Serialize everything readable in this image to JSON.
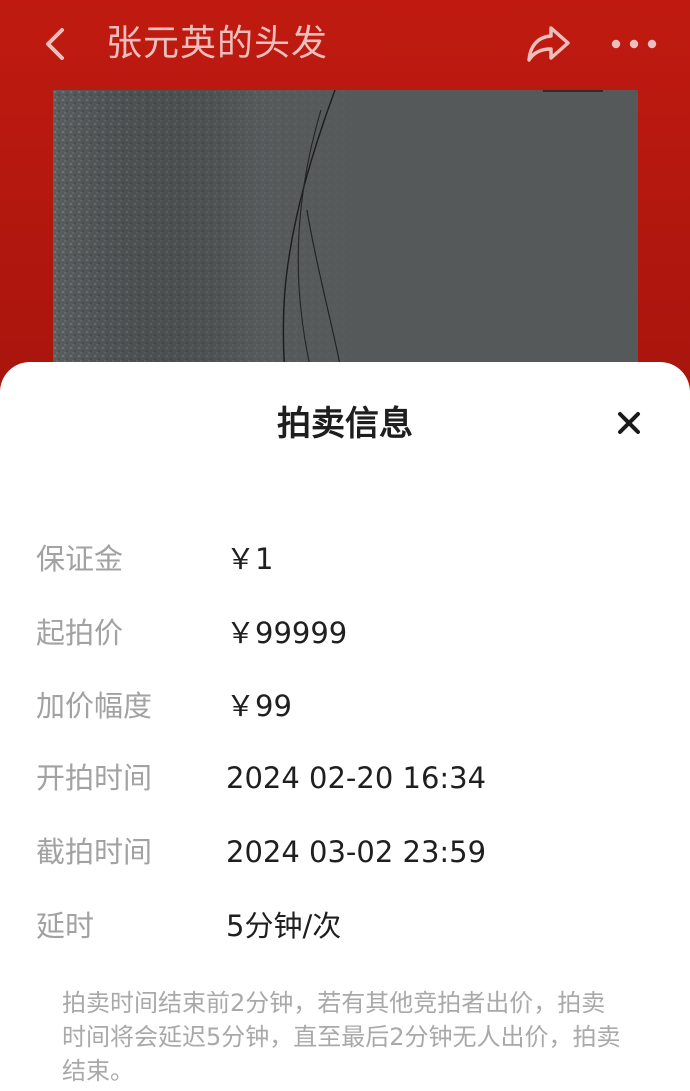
{
  "header": {
    "title": "张元英的头发",
    "back_icon": "chevron-left-icon",
    "share_icon": "share-icon",
    "more_icon": "more-horizontal-icon"
  },
  "product_image": {
    "description_icon": "product-photo"
  },
  "auction_sheet": {
    "title": "拍卖信息",
    "close_icon": "close-icon",
    "rows": [
      {
        "label": "保证金",
        "value": "￥1"
      },
      {
        "label": "起拍价",
        "value": "￥99999"
      },
      {
        "label": "加价幅度",
        "value": "￥99"
      },
      {
        "label": "开拍时间",
        "value": "2024 02-20 16:34"
      },
      {
        "label": "截拍时间",
        "value": "2024 03-02 23:59"
      },
      {
        "label": "延时",
        "value": "5分钟/次"
      }
    ],
    "note": "拍卖时间结束前2分钟，若有其他竞拍者出价，拍卖时间将会延迟5分钟，直至最后2分钟无人出价，拍卖结束。"
  },
  "colors": {
    "header_bg": "#b3170f",
    "sheet_bg": "#ffffff",
    "label_text": "#a2a2a2",
    "value_text": "#1f1f1f"
  }
}
